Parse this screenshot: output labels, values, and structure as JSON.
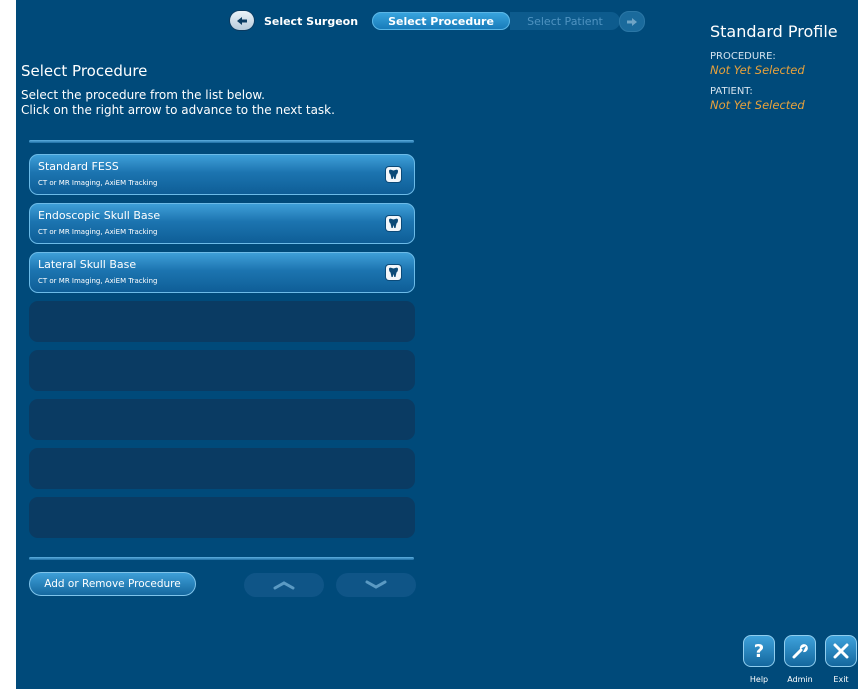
{
  "nav": {
    "back_icon": "left-arrow-icon",
    "next_icon": "right-arrow-icon",
    "steps": [
      "Select Surgeon",
      "Select Procedure",
      "Select Patient"
    ],
    "active_step": "Select Procedure"
  },
  "profile": {
    "title": "Standard Profile",
    "procedure_label": "PROCEDURE:",
    "procedure_value": "Not Yet Selected",
    "patient_label": "PATIENT:",
    "patient_value": "Not Yet Selected"
  },
  "main": {
    "title": "Select Procedure",
    "instructions": [
      "Select the procedure from the list below.",
      "Click on the right arrow to advance to the next task."
    ]
  },
  "procedures": [
    {
      "name": "Standard FESS",
      "desc": "CT or MR Imaging, AxiEM Tracking",
      "icon": "tooth-icon"
    },
    {
      "name": "Endoscopic Skull Base",
      "desc": "CT or MR Imaging, AxiEM Tracking",
      "icon": "tooth-icon"
    },
    {
      "name": "Lateral Skull Base",
      "desc": "CT or MR Imaging, AxiEM Tracking",
      "icon": "tooth-icon"
    }
  ],
  "empty_slots": 5,
  "footer": {
    "add_remove_label": "Add or Remove Procedure",
    "scroll_up_icon": "chevron-up-icon",
    "scroll_down_icon": "chevron-down-icon"
  },
  "tools": {
    "help_label": "Help",
    "admin_label": "Admin",
    "exit_label": "Exit",
    "help_icon": "question-icon",
    "admin_icon": "wrench-icon",
    "exit_icon": "close-icon"
  },
  "colors": {
    "background": "#004a7a",
    "accent": "#e9a23b"
  }
}
